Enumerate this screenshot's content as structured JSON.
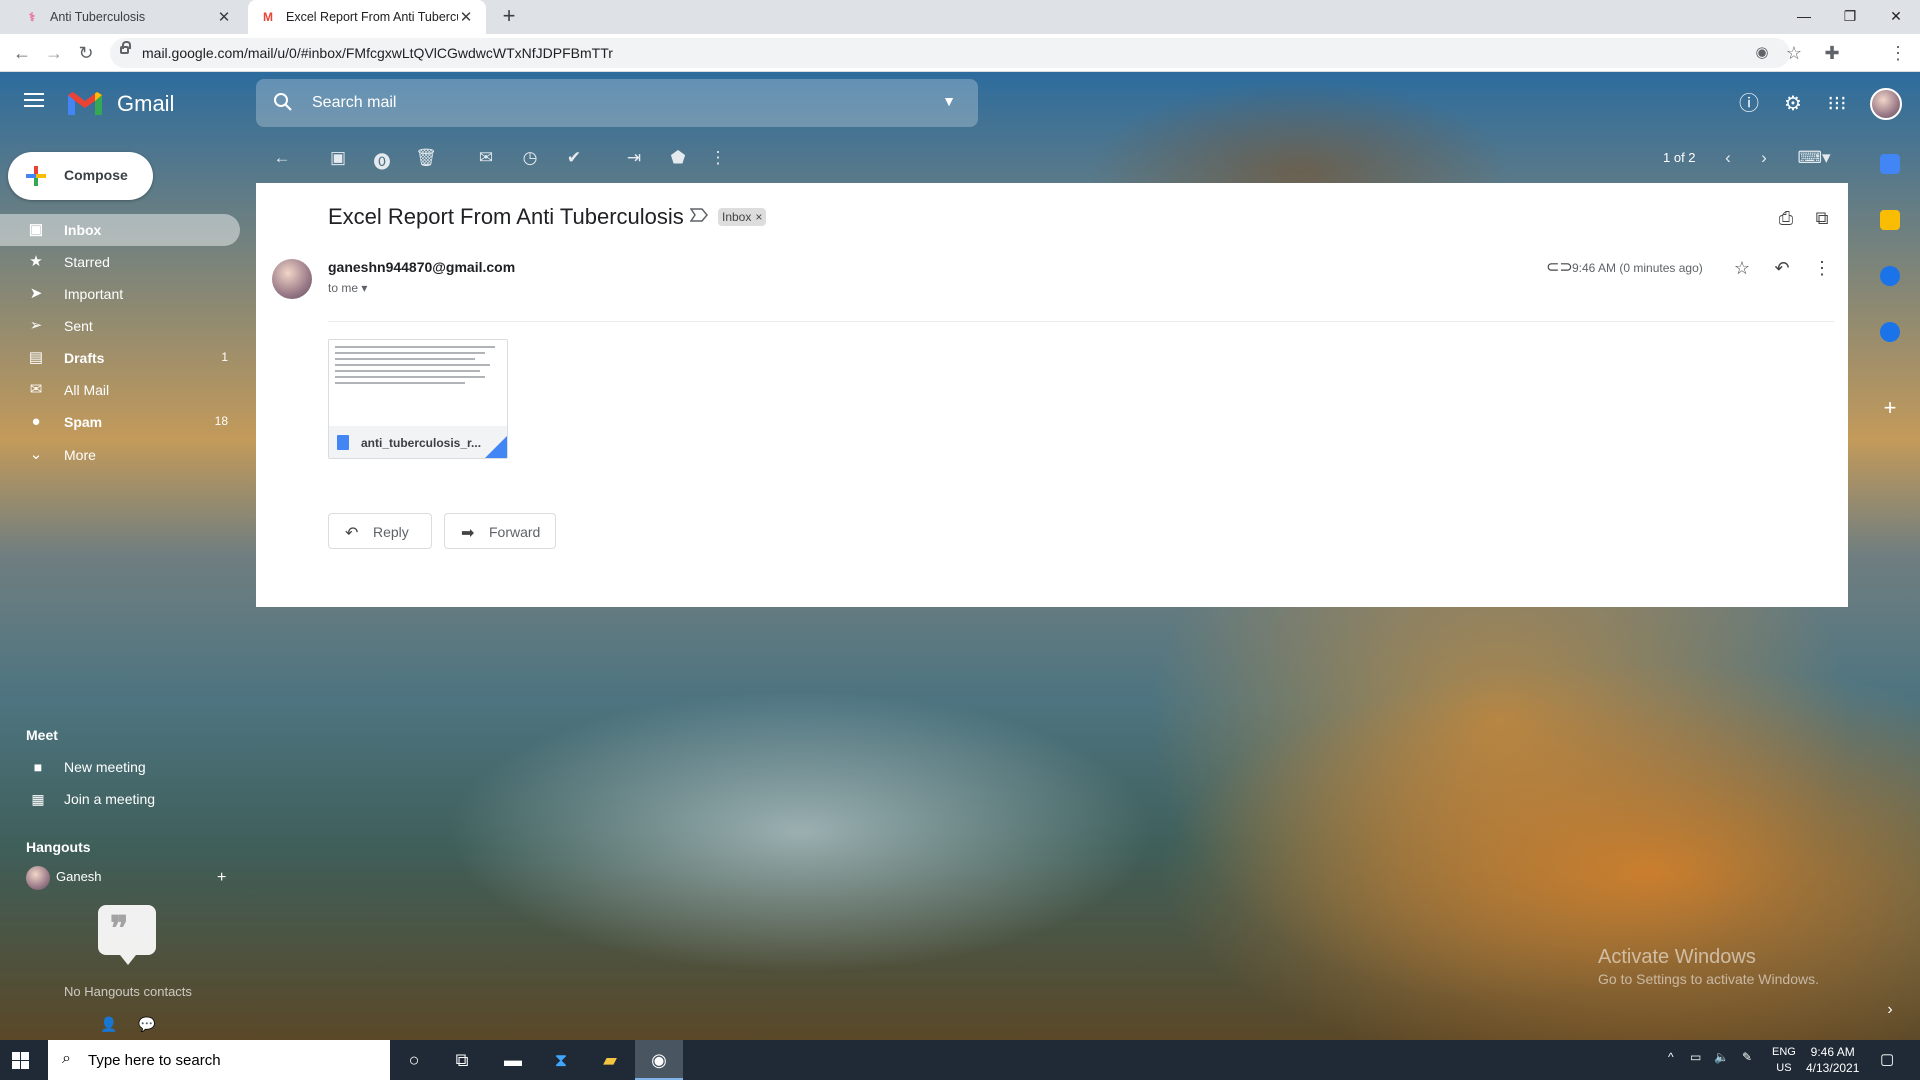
{
  "browser": {
    "tabs": [
      {
        "title": "Anti Tuberculosis",
        "active": false
      },
      {
        "title": "Excel Report From Anti Tuberculc",
        "active": true
      }
    ],
    "url": "mail.google.com/mail/u/0/#inbox/FMfcgxwLtQVlCGwdwcWTxNfJDPFBmTTr"
  },
  "gmail": {
    "logo_text": "Gmail",
    "search_placeholder": "Search mail",
    "compose_label": "Compose",
    "nav": [
      {
        "label": "Inbox",
        "icon": "inbox-icon",
        "count": "",
        "active": true,
        "bold": true
      },
      {
        "label": "Starred",
        "icon": "star-icon",
        "count": "",
        "active": false,
        "bold": false
      },
      {
        "label": "Important",
        "icon": "important-icon",
        "count": "",
        "active": false,
        "bold": false
      },
      {
        "label": "Sent",
        "icon": "send-icon",
        "count": "",
        "active": false,
        "bold": false
      },
      {
        "label": "Drafts",
        "icon": "draft-icon",
        "count": "1",
        "active": false,
        "bold": true
      },
      {
        "label": "All Mail",
        "icon": "mail-icon",
        "count": "",
        "active": false,
        "bold": false
      },
      {
        "label": "Spam",
        "icon": "spam-icon",
        "count": "18",
        "active": false,
        "bold": true
      },
      {
        "label": "More",
        "icon": "chevron-down-icon",
        "count": "",
        "active": false,
        "bold": false
      }
    ],
    "meet": {
      "heading": "Meet",
      "new_meeting": "New meeting",
      "join_meeting": "Join a meeting"
    },
    "hangouts": {
      "heading": "Hangouts",
      "user": "Ganesh",
      "empty_text": "No Hangouts contacts"
    },
    "pager": "1 of 2"
  },
  "message": {
    "subject": "Excel Report From Anti Tuberculosis",
    "label": "Inbox",
    "sender": "ganeshn944870@gmail.com",
    "to_me": "to me",
    "time": "9:46 AM (0 minutes ago)",
    "attachment_name": "anti_tuberculosis_r...",
    "reply_label": "Reply",
    "forward_label": "Forward"
  },
  "watermark": {
    "line1": "Activate Windows",
    "line2": "Go to Settings to activate Windows."
  },
  "taskbar": {
    "search_placeholder": "Type here to search",
    "lang1": "ENG",
    "lang2": "US",
    "time": "9:46 AM",
    "date": "4/13/2021"
  }
}
